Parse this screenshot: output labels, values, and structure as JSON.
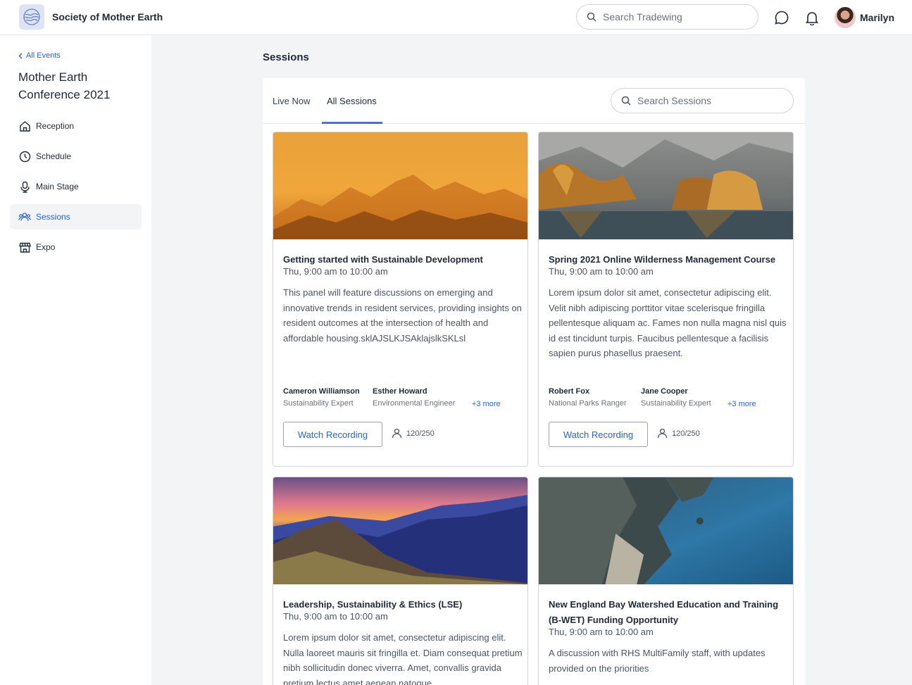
{
  "header": {
    "org_name": "Society of Mother Earth",
    "search_placeholder": "Search Tradewing",
    "user_name": "Marilyn"
  },
  "sidebar": {
    "back_label": "All Events",
    "event_title": "Mother Earth Conference 2021",
    "items": [
      {
        "label": "Reception",
        "icon": "home-icon"
      },
      {
        "label": "Schedule",
        "icon": "clock-icon"
      },
      {
        "label": "Main Stage",
        "icon": "microphone-icon"
      },
      {
        "label": "Sessions",
        "icon": "users-icon",
        "active": true
      },
      {
        "label": "Expo",
        "icon": "store-icon"
      }
    ]
  },
  "main": {
    "heading": "Sessions",
    "tabs": [
      {
        "label": "Live Now"
      },
      {
        "label": "All Sessions",
        "active": true
      }
    ],
    "search_placeholder": "Search Sessions",
    "cards": [
      {
        "title": "Getting started with Sustainable Development",
        "time": "Thu, 9:00 am to 10:00 am",
        "description": "This panel will feature discussions on emerging and innovative trends in resident services, providing insights on resident outcomes at the intersection of health and affordable housing.sklAJSLKJSAklajslkSKLsl",
        "speakers": [
          {
            "name": "Cameron Williamson",
            "role": "Sustainability Expert"
          },
          {
            "name": "Esther Howard",
            "role": "Environmental Engineer"
          }
        ],
        "more": "+3 more",
        "button": "Watch Recording",
        "capacity": "120/250"
      },
      {
        "title": "Spring 2021 Online Wilderness Management Course",
        "time": "Thu, 9:00 am to 10:00 am",
        "description": "Lorem ipsum dolor sit amet, consectetur adipiscing elit. Velit nibh adipiscing porttitor vitae scelerisque fringilla pellentesque aliquam ac. Fames non nulla magna nisl quis id est tincidunt turpis. Faucibus pellentesque a facilisis sapien purus phasellus praesent.",
        "speakers": [
          {
            "name": "Robert Fox",
            "role": "National Parks Ranger"
          },
          {
            "name": "Jane Cooper",
            "role": "Sustainability Expert"
          }
        ],
        "more": "+3 more",
        "button": "Watch Recording",
        "capacity": "120/250"
      },
      {
        "title": "Leadership, Sustainability & Ethics (LSE)",
        "time": "Thu, 9:00 am to 10:00 am",
        "description": "Lorem ipsum dolor sit amet, consectetur adipiscing elit. Nulla laoreet mauris sit fringilla et. Diam consequat pretium nibh sollicitudin donec viverra. Amet, convallis gravida pretium lectus amet aenean natoque."
      },
      {
        "title": "New England Bay Watershed Education and Training (B-WET) Funding Opportunity",
        "time": "Thu, 9:00 am to 10:00 am",
        "description": "A discussion with RHS MultiFamily staff, with updates provided on the priorities"
      }
    ]
  }
}
